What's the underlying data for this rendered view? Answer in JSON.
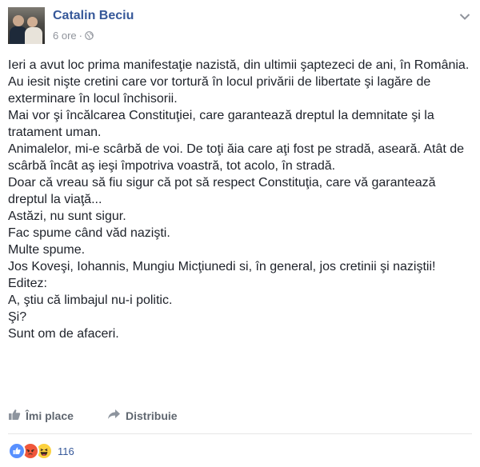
{
  "post": {
    "author": "Catalin Beciu",
    "time": "6 ore",
    "separator": "·",
    "body": "Ieri a avut loc prima manifestaţie nazistă, din ultimii şaptezeci de ani, în România.\nAu iesit nişte cretini care vor tortură în locul privării de libertate şi lagăre de exterminare în locul închisorii.\nMai vor şi încălcarea Constituţiei, care garantează dreptul la demnitate şi la tratament uman.\nAnimalelor, mi-e scârbă de voi. De toţi ăia care aţi fost pe stradă, aseară. Atât de scârbă încât aş ieşi împotriva voastră, tot acolo, în stradă.\nDoar că vreau să fiu sigur că pot să respect Constituţia, care vă garantează dreptul la viaţă...\nAstăzi, nu sunt sigur.\nFac spume când văd nazişti.\nMulte spume.\nJos Koveşi, Iohannis, Mungiu Micţiunedi si, în general, jos cretinii şi naziştii!\nEditez:\nA, ştiu că limbajul nu-i politic.\nŞi?\nSunt om de afaceri."
  },
  "actions": {
    "like_label": "Îmi place",
    "share_label": "Distribuie"
  },
  "reactions": {
    "count": "116",
    "icons": [
      "like-icon",
      "angry-icon",
      "haha-icon"
    ],
    "colors": {
      "like": "#5890ff",
      "angry": "#f0573b",
      "haha": "#fcd13e"
    }
  },
  "icons": {
    "privacy": "globe-icon",
    "menu": "chevron-down-icon",
    "like": "thumbs-up-icon",
    "share": "share-arrow-icon"
  },
  "colors": {
    "name_link": "#365899",
    "meta_text": "#90949c",
    "action_text": "#606770"
  }
}
